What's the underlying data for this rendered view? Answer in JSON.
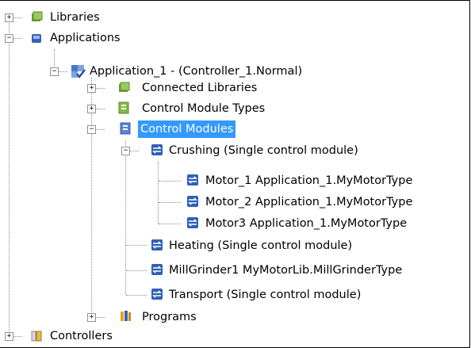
{
  "tree": {
    "libraries": {
      "label": "Libraries"
    },
    "applications": {
      "label": "Applications"
    },
    "application_1": {
      "label": "Application_1 - (Controller_1.Normal)"
    },
    "connected_libraries": {
      "label": "Connected Libraries"
    },
    "control_module_types": {
      "label": "Control Module Types"
    },
    "control_modules": {
      "label": "Control Modules"
    },
    "crushing": {
      "label": "Crushing   (Single control module)"
    },
    "motor_1": {
      "label": "Motor_1   Application_1.MyMotorType"
    },
    "motor_2": {
      "label": "Motor_2   Application_1.MyMotorType"
    },
    "motor3": {
      "label": "Motor3   Application_1.MyMotorType"
    },
    "heating": {
      "label": "Heating   (Single control module)"
    },
    "millgrinder1": {
      "label": "MillGrinder1   MyMotorLib.MillGrinderType"
    },
    "transport": {
      "label": "Transport   (Single control module)"
    },
    "programs": {
      "label": "Programs"
    },
    "controllers": {
      "label": "Controllers"
    }
  },
  "expander": {
    "plus": "+",
    "minus": "−"
  },
  "colors": {
    "selection": "#3399ff",
    "cm_icon": "#2f5fb8"
  }
}
